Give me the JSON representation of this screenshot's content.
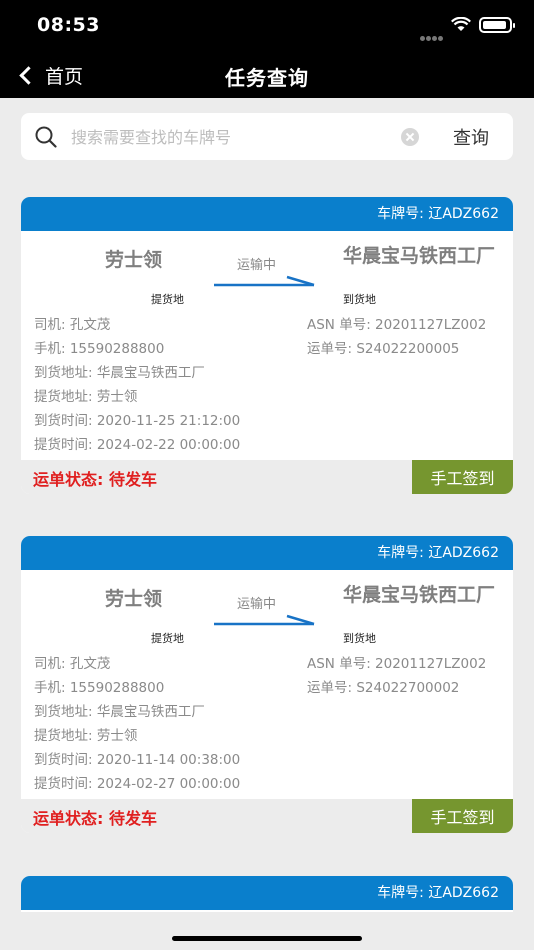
{
  "status_bar": {
    "time": "08:53"
  },
  "nav": {
    "back_label": "首页",
    "title": "任务查询"
  },
  "search": {
    "placeholder": "搜索需要查找的车牌号",
    "button_label": "查询",
    "value": ""
  },
  "tasks": [
    {
      "plate": "车牌号: 辽ADZ662",
      "origin": "劳士领",
      "origin_label": "提货地",
      "status": "运输中",
      "destination": "华晨宝马铁西工厂",
      "destination_label": "到货地",
      "driver": "司机: 孔文茂",
      "phone": "手机: 15590288800",
      "arrival_address": "到货地址: 华晨宝马铁西工厂",
      "pickup_address": "提货地址: 劳士领",
      "arrival_time": "到货时间: 2020-11-25 21:12:00",
      "pickup_time": "提货时间: 2024-02-22 00:00:00",
      "asn": "ASN 单号: 20201127LZ002",
      "waybill": "运单号: S24022200005",
      "order_status": "运单状态: 待发车",
      "action_label": "手工签到"
    },
    {
      "plate": "车牌号: 辽ADZ662",
      "origin": "劳士领",
      "origin_label": "提货地",
      "status": "运输中",
      "destination": "华晨宝马铁西工厂",
      "destination_label": "到货地",
      "driver": "司机: 孔文茂",
      "phone": "手机: 15590288800",
      "arrival_address": "到货地址: 华晨宝马铁西工厂",
      "pickup_address": "提货地址: 劳士领",
      "arrival_time": "到货时间: 2020-11-14 00:38:00",
      "pickup_time": "提货时间: 2024-02-27 00:00:00",
      "asn": "ASN 单号: 20201127LZ002",
      "waybill": "运单号: S24022700002",
      "order_status": "运单状态: 待发车",
      "action_label": "手工签到"
    },
    {
      "plate": "车牌号: 辽ADZ662"
    }
  ],
  "colors": {
    "header_blue": "#0a7fcc",
    "status_red": "#e02020",
    "checkin_green": "#76962f",
    "background": "#ececec"
  }
}
